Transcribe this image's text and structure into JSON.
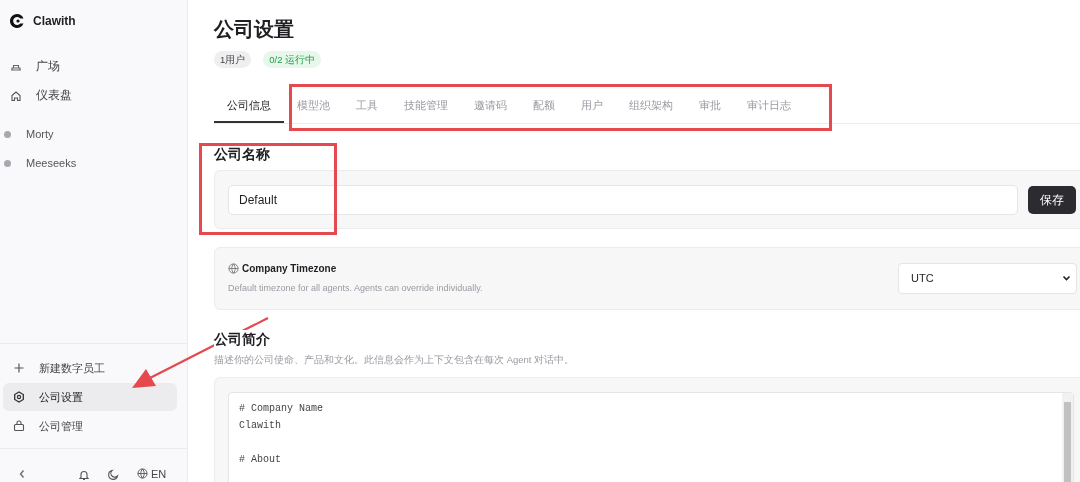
{
  "sidebar": {
    "brand": "Clawith",
    "nav": [
      {
        "label": "广场",
        "kind": "plaza"
      },
      {
        "label": "仪表盘",
        "kind": "home"
      }
    ],
    "agents": [
      {
        "name": "Morty"
      },
      {
        "name": "Meeseeks"
      }
    ],
    "actions": [
      {
        "label": "新建数字员工",
        "kind": "create",
        "selected": false
      },
      {
        "label": "公司设置",
        "kind": "settings",
        "selected": true
      },
      {
        "label": "公司管理",
        "kind": "manage",
        "selected": false
      }
    ],
    "footer": {
      "language": "EN"
    }
  },
  "page": {
    "title": "公司设置",
    "badges": [
      {
        "text": "1用户",
        "kind": "neutral"
      },
      {
        "text": "0/2 运行中",
        "kind": "success"
      }
    ]
  },
  "tabs": [
    {
      "label": "公司信息",
      "selected": true
    },
    {
      "label": "模型池",
      "selected": false
    },
    {
      "label": "工具",
      "selected": false
    },
    {
      "label": "技能管理",
      "selected": false
    },
    {
      "label": "邀请码",
      "selected": false
    },
    {
      "label": "配额",
      "selected": false
    },
    {
      "label": "用户",
      "selected": false
    },
    {
      "label": "组织架构",
      "selected": false
    },
    {
      "label": "审批",
      "selected": false
    },
    {
      "label": "审计日志",
      "selected": false
    }
  ],
  "company_name": {
    "heading": "公司名称",
    "value": "Default",
    "button": "保存"
  },
  "timezone": {
    "title": "Company Timezone",
    "description": "Default timezone for all agents. Agents can override individually.",
    "value": "UTC"
  },
  "intro": {
    "heading": "公司简介",
    "description": "描述你的公司使命、产品和文化。此信息会作为上下文包含在每次 Agent 对话中。",
    "paragraphs": [
      [
        "# Company Name",
        "Clawith"
      ],
      [
        "# About"
      ]
    ]
  },
  "annotations": [
    {
      "kind": "box"
    },
    {
      "kind": "box"
    },
    {
      "kind": "arrow"
    }
  ]
}
